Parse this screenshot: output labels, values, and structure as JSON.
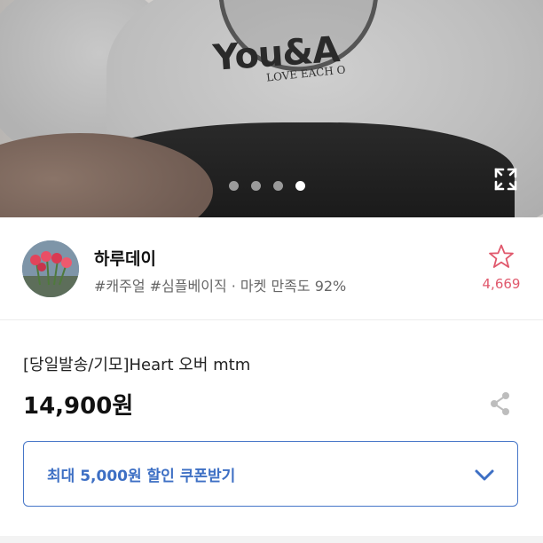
{
  "gallery": {
    "print_text": "You&A",
    "print_subtext": "LOVE EACH O",
    "total_images": 4,
    "active_image_index": 4
  },
  "seller": {
    "name": "하루데이",
    "tags": "#캐주얼 #심플베이직 · 마켓 만족도 92%",
    "favorite_count": "4,669"
  },
  "product": {
    "title": "[당일발송/기모]Heart 오버 mtm",
    "price": "14,900원"
  },
  "coupon": {
    "label": "최대 5,000원 할인 쿠폰받기"
  },
  "colors": {
    "accent_blue": "#3d6fc4",
    "favorite_pink": "#e0586c"
  },
  "icons": {
    "expand": "expand-icon",
    "star": "star-outline-icon",
    "share": "share-icon",
    "chevron": "chevron-down-icon"
  }
}
